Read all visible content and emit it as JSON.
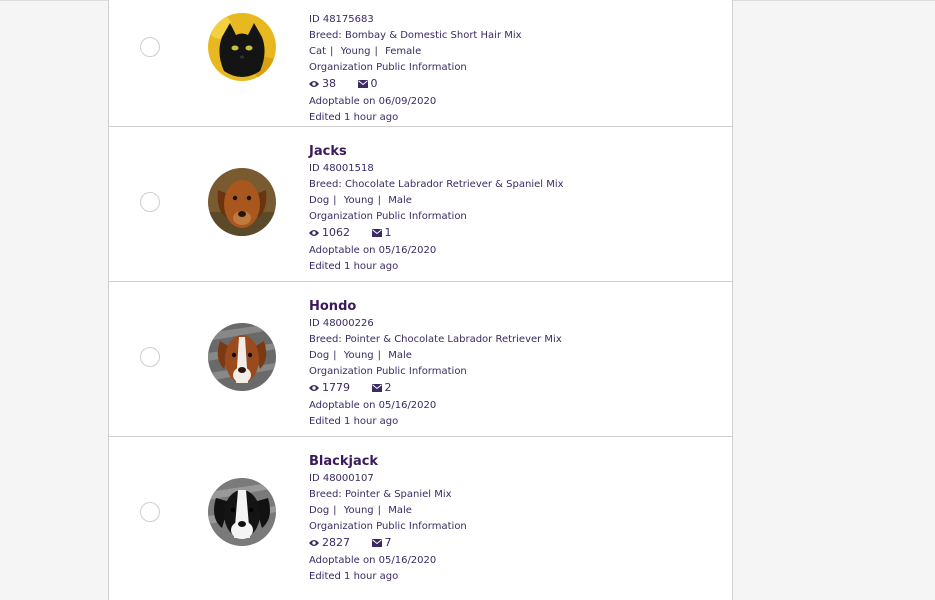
{
  "pets": [
    {
      "name": "",
      "id_line": "ID 48175683",
      "breed": "Breed: Bombay & Domestic Short Hair Mix",
      "species": "Cat",
      "age": "Young",
      "sex": "Female",
      "org_info": "Organization Public Information",
      "views": "38",
      "messages": "0",
      "adoptable": "Adoptable on 06/09/2020",
      "edited": "Edited 1 hour ago"
    },
    {
      "name": "Jacks",
      "id_line": "ID 48001518",
      "breed": "Breed: Chocolate Labrador Retriever & Spaniel Mix",
      "species": "Dog",
      "age": "Young",
      "sex": "Male",
      "org_info": "Organization Public Information",
      "views": "1062",
      "messages": "1",
      "adoptable": "Adoptable on 05/16/2020",
      "edited": "Edited 1 hour ago"
    },
    {
      "name": "Hondo",
      "id_line": "ID 48000226",
      "breed": "Breed: Pointer & Chocolate Labrador Retriever Mix",
      "species": "Dog",
      "age": "Young",
      "sex": "Male",
      "org_info": "Organization Public Information",
      "views": "1779",
      "messages": "2",
      "adoptable": "Adoptable on 05/16/2020",
      "edited": "Edited 1 hour ago"
    },
    {
      "name": "Blackjack",
      "id_line": "ID 48000107",
      "breed": "Breed: Pointer & Spaniel Mix",
      "species": "Dog",
      "age": "Young",
      "sex": "Male",
      "org_info": "Organization Public Information",
      "views": "2827",
      "messages": "7",
      "adoptable": "Adoptable on 05/16/2020",
      "edited": "Edited 1 hour ago"
    }
  ],
  "separator": "|",
  "colors": {
    "text": "#3b2a63",
    "name": "#3a1a5a",
    "border": "#cfcfcf",
    "background": "#f5f5f5"
  },
  "icons": {
    "views": "eye-icon",
    "messages": "envelope-icon"
  }
}
